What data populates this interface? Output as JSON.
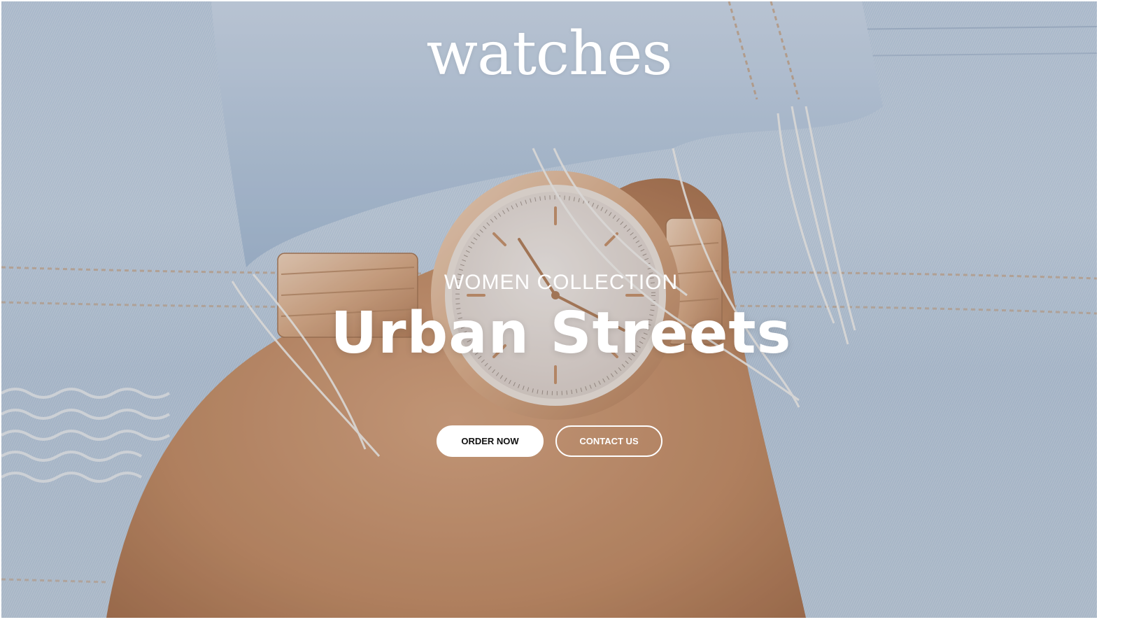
{
  "brand": {
    "logo_text": "watches"
  },
  "hero": {
    "eyebrow": "WOMEN COLLECTION",
    "title": "Urban Streets",
    "background_image": "denim-wrist-rose-gold-watch"
  },
  "actions": {
    "order_label": "ORDER NOW",
    "contact_label": "CONTACT US"
  },
  "colors": {
    "text": "#ffffff",
    "primary_button_bg": "#ffffff",
    "primary_button_text": "#111111",
    "denim": "#c4d4e6",
    "skin": "#c8946c",
    "rose_gold": "#e2b999"
  }
}
